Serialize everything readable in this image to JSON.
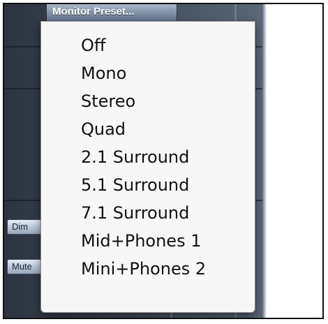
{
  "header": {
    "preset_button_label": "Monitor Preset..."
  },
  "side_buttons": {
    "dim_label": "Dim",
    "mute_label": "Mute"
  },
  "menu": {
    "items": [
      {
        "label": "Off"
      },
      {
        "label": "Mono"
      },
      {
        "label": "Stereo"
      },
      {
        "label": "Quad"
      },
      {
        "label": "2.1 Surround"
      },
      {
        "label": "5.1 Surround"
      },
      {
        "label": "7.1 Surround"
      },
      {
        "label": "Mid+Phones 1"
      },
      {
        "label": "Mini+Phones 2"
      }
    ]
  },
  "colors": {
    "app_background": "#3c4654",
    "menu_background": "#f7f7f7",
    "menu_text": "#111111",
    "button_accent": "#7d8ea4"
  }
}
